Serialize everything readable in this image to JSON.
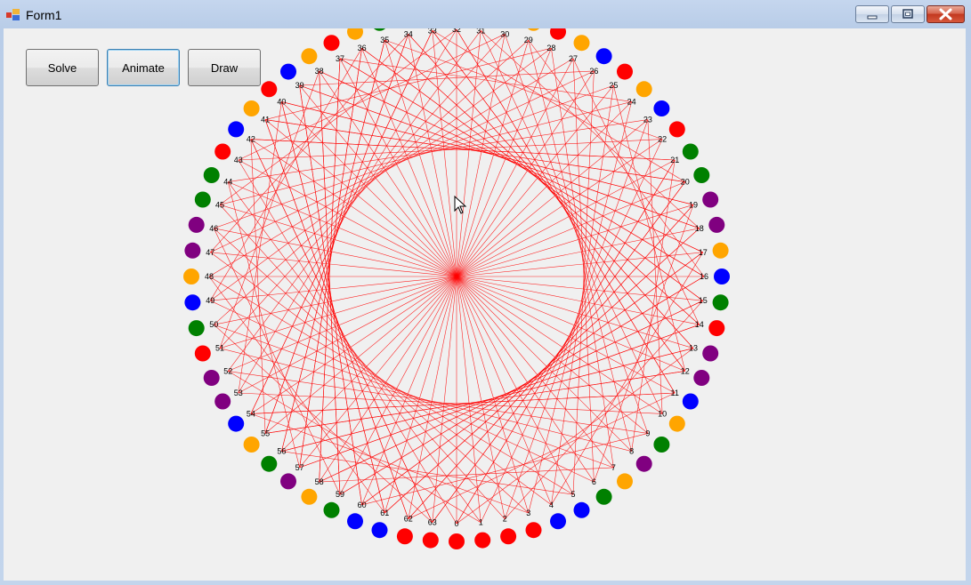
{
  "window": {
    "title": "Form1"
  },
  "toolbar": {
    "solve_label": "Solve",
    "animate_label": "Animate",
    "draw_label": "Draw"
  },
  "icons": {
    "app": "form-app-icon",
    "minimize": "minimize-icon",
    "maximize": "maximize-icon",
    "close": "close-icon",
    "cursor": "mouse-pointer-icon"
  },
  "colors": {
    "line": "#ff0000",
    "purple": "#800080",
    "orange": "#ffa500",
    "green": "#008000",
    "blue": "#0000ff",
    "red": "#ff0000"
  },
  "circle": {
    "labels": [
      "0",
      "1",
      "2",
      "3",
      "4",
      "5",
      "6",
      "7",
      "8",
      "9",
      "10",
      "11",
      "12",
      "13",
      "14",
      "15",
      "16",
      "17",
      "18",
      "19",
      "20",
      "21",
      "22",
      "23",
      "24",
      "25",
      "26",
      "27",
      "28",
      "29",
      "30",
      "31",
      "32",
      "33",
      "34",
      "35",
      "36",
      "37",
      "38",
      "39",
      "40",
      "41",
      "42",
      "43",
      "44",
      "45",
      "46",
      "47",
      "48",
      "49",
      "50",
      "51",
      "52",
      "53",
      "54",
      "55",
      "56",
      "57",
      "58",
      "59",
      "60",
      "61",
      "62",
      "63"
    ],
    "dot_colors": [
      "red",
      "red",
      "red",
      "red",
      "blue",
      "blue",
      "green",
      "orange",
      "purple",
      "green",
      "orange",
      "blue",
      "purple",
      "purple",
      "red",
      "green",
      "blue",
      "orange",
      "purple",
      "purple",
      "green",
      "green",
      "red",
      "blue",
      "orange",
      "red",
      "blue",
      "orange",
      "red",
      "orange",
      "green",
      "red",
      "red",
      "purple",
      "red",
      "green",
      "orange",
      "red",
      "orange",
      "blue",
      "red",
      "orange",
      "blue",
      "red",
      "green",
      "green",
      "purple",
      "purple",
      "orange",
      "blue",
      "green",
      "red",
      "purple",
      "purple",
      "blue",
      "orange",
      "green",
      "purple",
      "orange",
      "green",
      "blue",
      "blue",
      "red",
      "red"
    ]
  }
}
